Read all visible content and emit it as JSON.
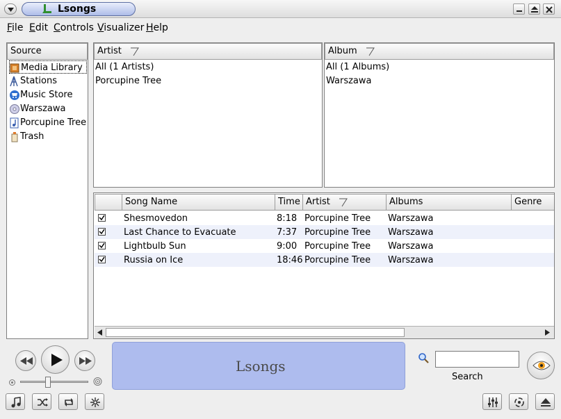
{
  "window": {
    "title": "Lsongs"
  },
  "menubar": [
    {
      "accel": "F",
      "rest": "ile"
    },
    {
      "accel": "E",
      "rest": "dit"
    },
    {
      "accel": "C",
      "rest": "ontrols"
    },
    {
      "accel": "V",
      "rest": "isualizer"
    },
    {
      "accel": "H",
      "rest": "elp"
    }
  ],
  "source": {
    "header": "Source",
    "items": [
      {
        "label": "Media Library",
        "icon": "media-library-icon"
      },
      {
        "label": "Stations",
        "icon": "antenna-icon"
      },
      {
        "label": "Music Store",
        "icon": "shopping-cart-icon"
      },
      {
        "label": "Warszawa",
        "icon": "cd-icon"
      },
      {
        "label": "Porcupine Tree",
        "icon": "music-note-icon"
      },
      {
        "label": "Trash",
        "icon": "trash-icon"
      }
    ]
  },
  "artist_browser": {
    "header": "Artist",
    "items": [
      "All (1 Artists)",
      "Porcupine Tree"
    ]
  },
  "album_browser": {
    "header": "Album",
    "items": [
      "All (1 Albums)",
      "Warszawa"
    ]
  },
  "songs": {
    "columns": [
      "Song Name",
      "Time",
      "Artist",
      "Albums",
      "Genre"
    ],
    "rows": [
      {
        "checked": true,
        "name": "Shesmovedon",
        "time": "8:18",
        "artist": "Porcupine Tree",
        "album": "Warszawa"
      },
      {
        "checked": true,
        "name": "Last Chance to Evacuate",
        "time": "7:37",
        "artist": "Porcupine Tree",
        "album": "Warszawa"
      },
      {
        "checked": true,
        "name": "Lightbulb Sun",
        "time": "9:00",
        "artist": "Porcupine Tree",
        "album": "Warszawa"
      },
      {
        "checked": true,
        "name": "Russia on Ice",
        "time": "18:46",
        "artist": "Porcupine Tree",
        "album": "Warszawa"
      }
    ]
  },
  "player": {
    "logo_letter": "L",
    "logo_text": "songs",
    "volume": 0.4
  },
  "search": {
    "label": "Search",
    "value": ""
  },
  "colors": {
    "accent": "#aebcee",
    "row_alt": "#eef1fb"
  }
}
